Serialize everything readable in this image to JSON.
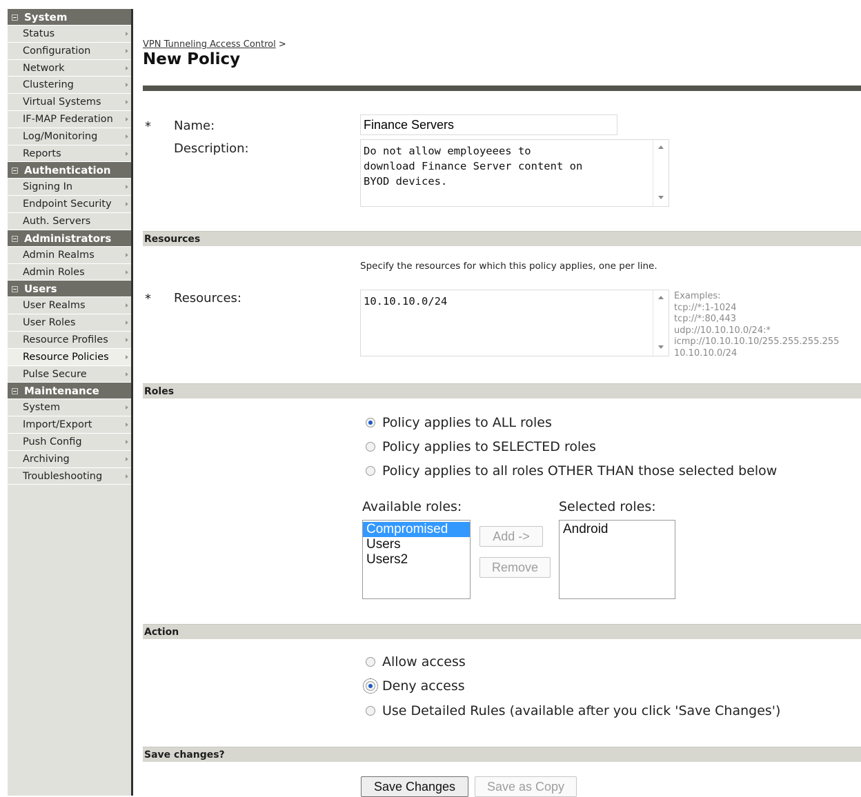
{
  "sidebar": {
    "sections": [
      {
        "title": "System",
        "items": [
          "Status",
          "Configuration",
          "Network",
          "Clustering",
          "Virtual Systems",
          "IF-MAP Federation",
          "Log/Monitoring",
          "Reports"
        ]
      },
      {
        "title": "Authentication",
        "items": [
          "Signing In",
          "Endpoint Security",
          "Auth. Servers"
        ]
      },
      {
        "title": "Administrators",
        "items": [
          "Admin Realms",
          "Admin Roles"
        ]
      },
      {
        "title": "Users",
        "items": [
          "User Realms",
          "User Roles",
          "Resource Profiles",
          "Resource Policies",
          "Pulse Secure"
        ]
      },
      {
        "title": "Maintenance",
        "items": [
          "System",
          "Import/Export",
          "Push Config",
          "Archiving",
          "Troubleshooting"
        ]
      }
    ],
    "active_item": "Resource Policies"
  },
  "header": {
    "breadcrumb_link": "VPN Tunneling Access Control",
    "breadcrumb_sep": ">",
    "title": "New Policy"
  },
  "form": {
    "required_mark": "*",
    "name_label": "Name:",
    "name_value": "Finance Servers",
    "description_label": "Description:",
    "description_value": "Do not allow employeees to\ndownload Finance Server content on\nBYOD devices."
  },
  "resources": {
    "section_title": "Resources",
    "hint": "Specify the resources for which this policy applies, one per line.",
    "label": "Resources:",
    "value": "10.10.10.0/24",
    "examples": [
      "Examples:",
      "tcp://*:1-1024",
      "tcp://*:80,443",
      "udp://10.10.10.0/24:*",
      "icmp://10.10.10.10/255.255.255.255",
      "10.10.10.0/24"
    ]
  },
  "roles": {
    "section_title": "Roles",
    "options": [
      "Policy applies to ALL roles",
      "Policy applies to SELECTED roles",
      "Policy applies to all roles OTHER THAN those selected below"
    ],
    "selected_option": 0,
    "available_label": "Available roles:",
    "available": [
      "Compromised",
      "Users",
      "Users2"
    ],
    "available_selected": "Compromised",
    "selected_label": "Selected roles:",
    "selected": [
      "Android"
    ],
    "add_button": "Add ->",
    "remove_button": "Remove"
  },
  "action": {
    "section_title": "Action",
    "options": [
      "Allow access",
      "Deny access",
      "Use Detailed Rules (available after you click 'Save Changes')"
    ],
    "selected_option": 1
  },
  "save": {
    "section_title": "Save changes?",
    "save_button": "Save Changes",
    "save_copy_button": "Save as Copy"
  }
}
